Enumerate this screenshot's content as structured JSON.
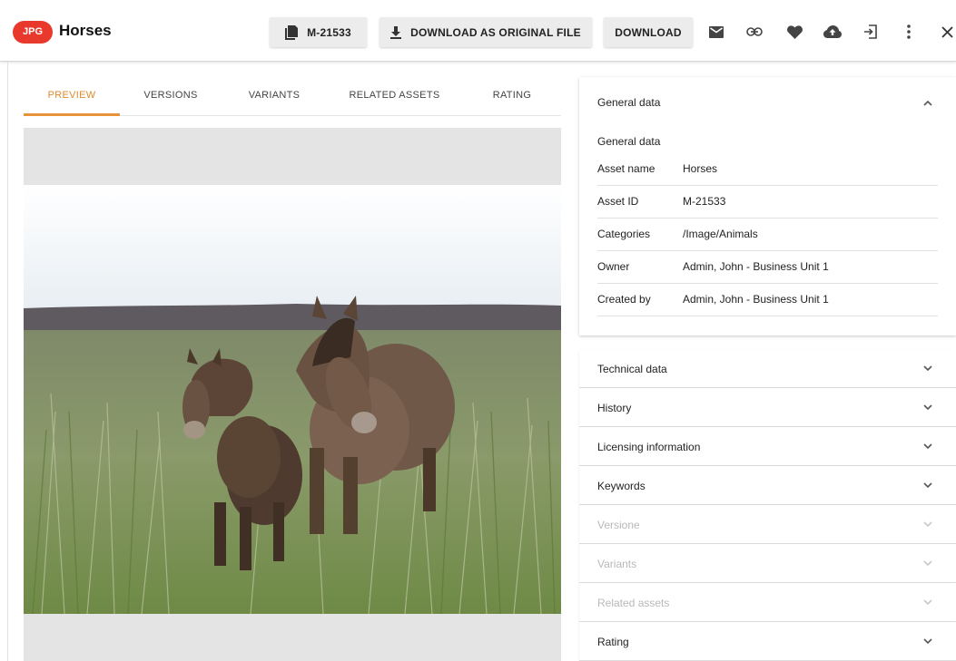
{
  "header": {
    "file_type_badge": "JPG",
    "title": "Horses",
    "asset_id_button": "M-21533",
    "download_original_button": "DOWNLOAD AS ORIGINAL FILE",
    "download_button": "DOWNLOAD",
    "icons": [
      "mail-icon",
      "link-icon",
      "heart-icon",
      "cloud-upload-icon",
      "exit-icon",
      "more-vert-icon",
      "close-icon"
    ]
  },
  "tabs": [
    {
      "label": "PREVIEW",
      "active": true
    },
    {
      "label": "VERSIONS",
      "active": false
    },
    {
      "label": "VARIANTS",
      "active": false
    },
    {
      "label": "RELATED ASSETS",
      "active": false
    },
    {
      "label": "RATING",
      "active": false
    }
  ],
  "general": {
    "header": "General data",
    "subheader": "General data",
    "rows": [
      {
        "key": "Asset name",
        "value": "Horses"
      },
      {
        "key": "Asset ID",
        "value": "M-21533"
      },
      {
        "key": "Categories",
        "value": "/Image/Animals"
      },
      {
        "key": "Owner",
        "value": "Admin, John - Business Unit 1"
      },
      {
        "key": "Created by",
        "value": "Admin, John - Business Unit 1"
      }
    ]
  },
  "accordions": [
    {
      "label": "Technical data",
      "disabled": false
    },
    {
      "label": "History",
      "disabled": false
    },
    {
      "label": "Licensing information",
      "disabled": false
    },
    {
      "label": "Keywords",
      "disabled": false
    },
    {
      "label": "Versione",
      "disabled": true
    },
    {
      "label": "Variants",
      "disabled": true
    },
    {
      "label": "Related assets",
      "disabled": true
    },
    {
      "label": "Rating",
      "disabled": false
    }
  ],
  "colors": {
    "badge": "#e8392c",
    "active_tab": "#e08a2c",
    "button_bg": "#ececec",
    "disabled_text": "#b8b8b8"
  }
}
